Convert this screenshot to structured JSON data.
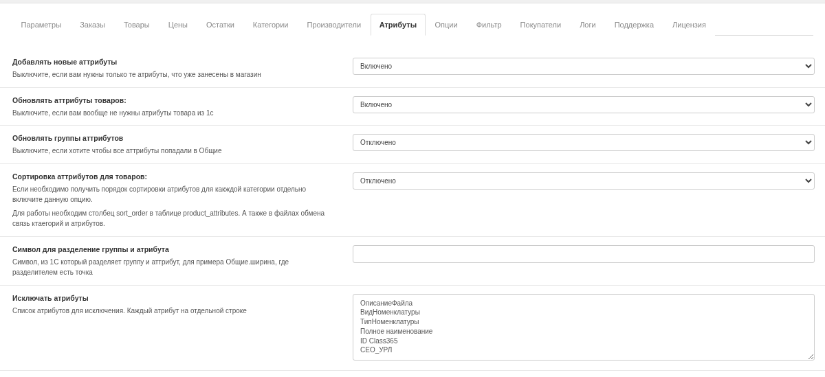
{
  "tabs": [
    {
      "label": "Параметры",
      "selected": false
    },
    {
      "label": "Заказы",
      "selected": false
    },
    {
      "label": "Товары",
      "selected": false
    },
    {
      "label": "Цены",
      "selected": false
    },
    {
      "label": "Остатки",
      "selected": false
    },
    {
      "label": "Категории",
      "selected": false
    },
    {
      "label": "Производители",
      "selected": false
    },
    {
      "label": "Атрибуты",
      "selected": true
    },
    {
      "label": "Опции",
      "selected": false
    },
    {
      "label": "Фильтр",
      "selected": false
    },
    {
      "label": "Покупатели",
      "selected": false
    },
    {
      "label": "Логи",
      "selected": false
    },
    {
      "label": "Поддержка",
      "selected": false
    },
    {
      "label": "Лицензия",
      "selected": false
    }
  ],
  "settings": [
    {
      "kind": "select",
      "title": "Добавлять новые аттрибуты",
      "description": [
        "Выключите, если вам нужны только те атрибуты, что уже занесены в магазин"
      ],
      "value": "Включено"
    },
    {
      "kind": "select",
      "title": "Обновлять аттрибуты товаров:",
      "description": [
        "Выключите, если вам вообще не нужны атрибуты товара из 1с"
      ],
      "value": "Включено"
    },
    {
      "kind": "select",
      "title": "Обновлять группы аттрибутов",
      "description": [
        "Выключите, если хотите чтобы все аттрибуты попадали в Общие"
      ],
      "value": "Отключено"
    },
    {
      "kind": "select",
      "title": "Сортировка аттрибутов для товаров:",
      "description": [
        "Если необходимо получить порядок сортировки атрибутов для какждой категории отдельно включите данную опцию.",
        "Для работы необходим столбец sort_order в таблице product_attributes. А также в файлах обмена связь ктаегорий и атрибутов."
      ],
      "value": "Отключено"
    },
    {
      "kind": "text",
      "title": "Символ для разделение группы и атрибута",
      "description": [
        "Символ, из 1С который разделяет группу и аттрибут, для примера Общие.ширина, где разделителем есть точка"
      ]
    },
    {
      "kind": "textarea",
      "title": "Исключать атрибуты",
      "description": [
        "Список атрибутов для исключения. Каждый атрибут на отдельной строке"
      ],
      "lines": [
        "ОписаниеФайла",
        "ВидНоменклатуры",
        "ТипНоменклатуры",
        "Полное наименование",
        "ID Class365",
        "СЕО_УРЛ"
      ]
    }
  ]
}
